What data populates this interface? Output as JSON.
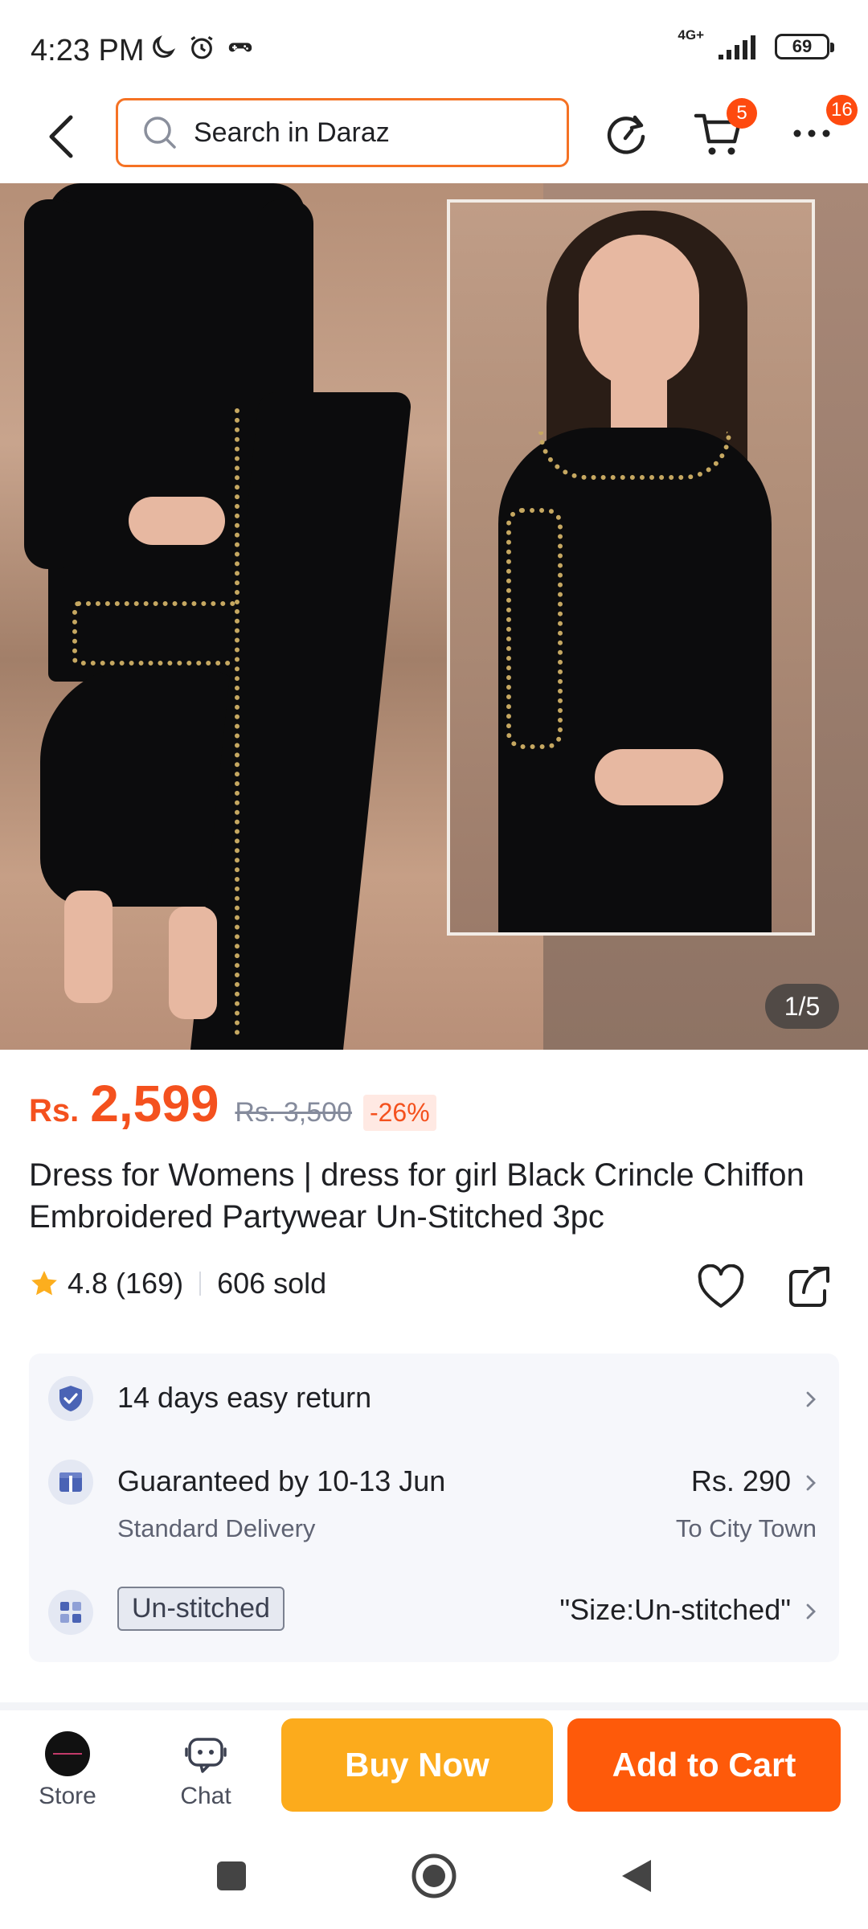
{
  "status_bar": {
    "time": "4:23 PM",
    "network": "4G+",
    "battery": "69"
  },
  "nav": {
    "search_placeholder": "Search in Daraz",
    "cart_count": "5",
    "more_count": "16"
  },
  "gallery": {
    "indicator": "1/5"
  },
  "product": {
    "currency": "Rs.",
    "price": "2,599",
    "original_price": "Rs. 3,500",
    "discount": "-26%",
    "title": "Dress for Womens | dress for girl Black Crincle Chiffon Embroidered Partywear Un-Stitched 3pc",
    "rating": "4.8",
    "review_count": "(169)",
    "sold": "606 sold"
  },
  "info": {
    "returns": "14 days easy return",
    "delivery_title": "Guaranteed by 10-13 Jun",
    "delivery_type": "Standard Delivery",
    "delivery_fee": "Rs. 290",
    "delivery_to": "To City Town",
    "variant_tag": "Un-stitched",
    "variant_value": "\"Size:Un-stitched\""
  },
  "actions": {
    "store_label": "Store",
    "chat_label": "Chat",
    "buy_now": "Buy Now",
    "add_to_cart": "Add to Cart"
  },
  "colors": {
    "accent": "#f57224",
    "price": "#f4511e",
    "buy_now": "#fcab1c",
    "add_to_cart": "#fe5a0a"
  }
}
